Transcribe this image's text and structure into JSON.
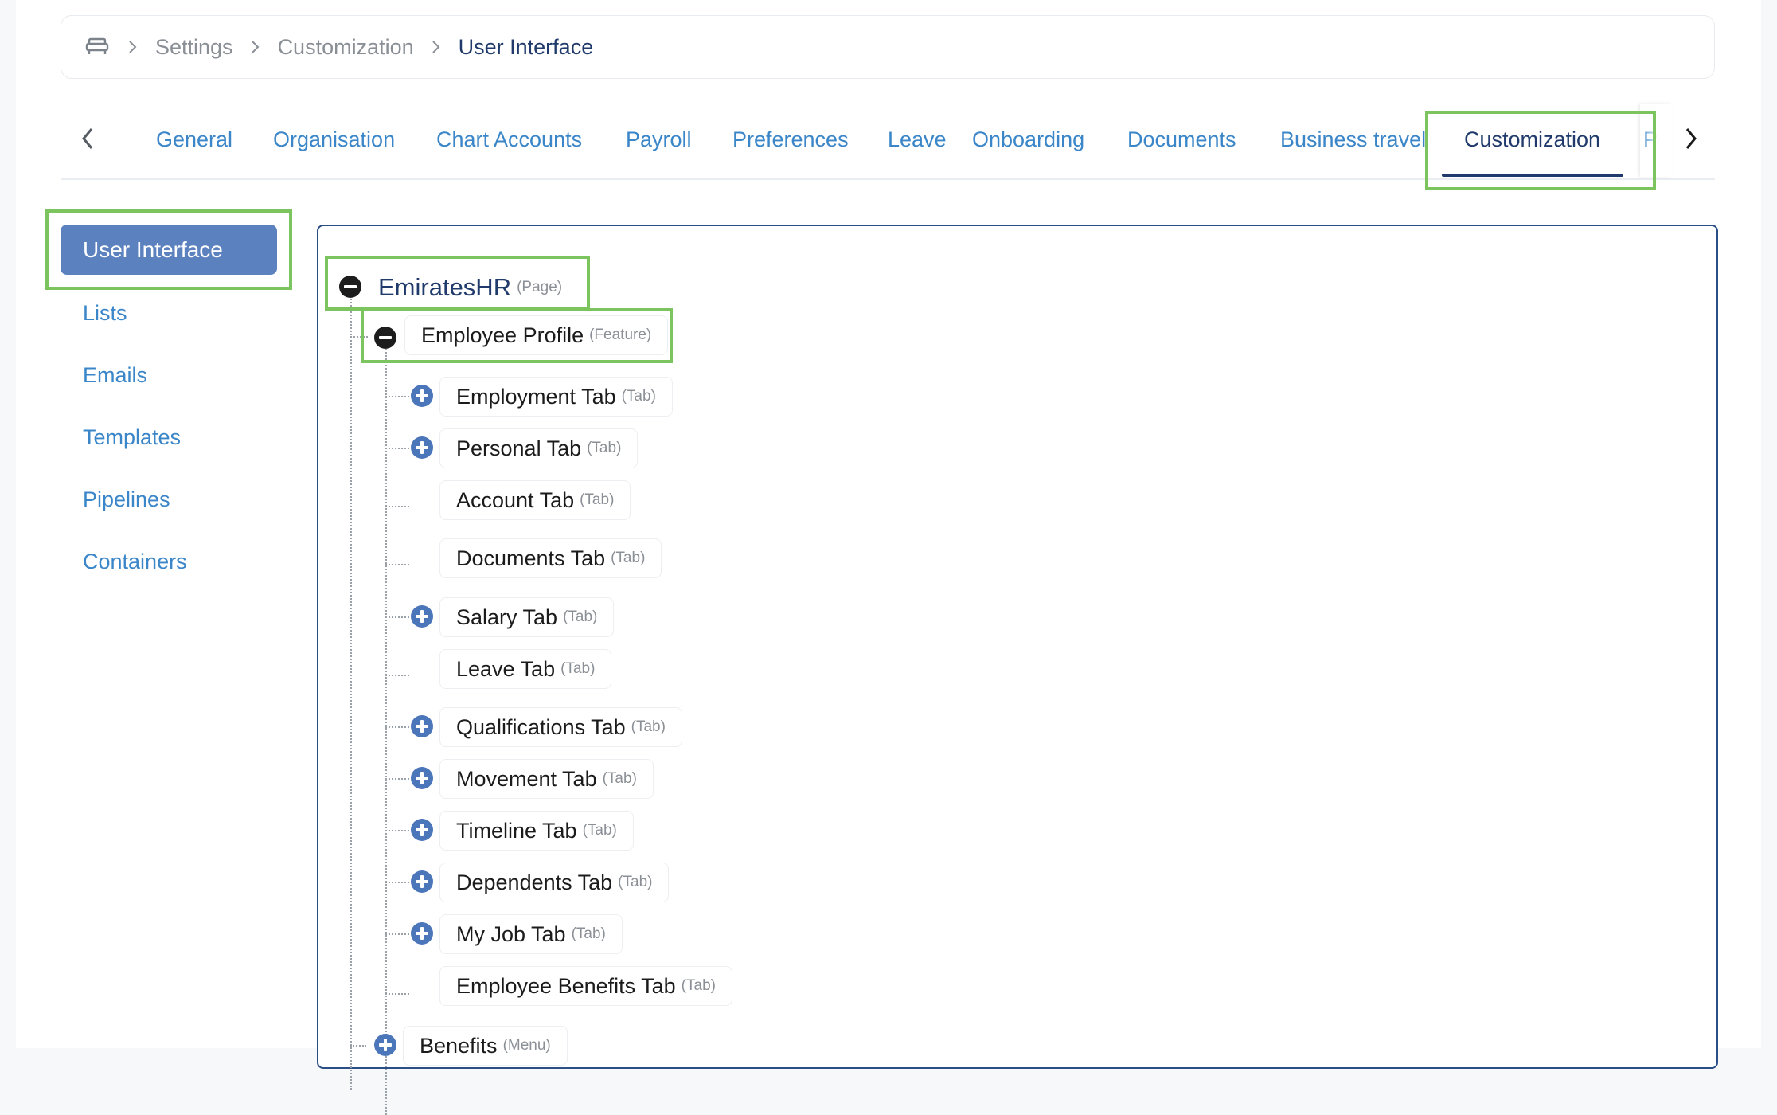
{
  "breadcrumb": {
    "items": [
      "Settings",
      "Customization",
      "User Interface"
    ]
  },
  "tabs": {
    "items": [
      "General",
      "Organisation",
      "Chart Accounts",
      "Payroll",
      "Preferences",
      "Leave",
      "Onboarding",
      "Documents",
      "Business travel",
      "Customization",
      "Pc"
    ],
    "active": "Customization"
  },
  "sidebar": {
    "active": "User Interface",
    "items": [
      "Lists",
      "Emails",
      "Templates",
      "Pipelines",
      "Containers"
    ]
  },
  "tree": {
    "root": {
      "label": "EmiratesHR",
      "type": "(Page)"
    },
    "feature": {
      "label": "Employee Profile",
      "type": "(Feature)"
    },
    "tabs": [
      {
        "label": "Employment Tab",
        "type": "(Tab)",
        "expandable": true
      },
      {
        "label": "Personal Tab",
        "type": "(Tab)",
        "expandable": true
      },
      {
        "label": "Account Tab",
        "type": "(Tab)",
        "expandable": false
      },
      {
        "label": "Documents Tab",
        "type": "(Tab)",
        "expandable": false
      },
      {
        "label": "Salary Tab",
        "type": "(Tab)",
        "expandable": true
      },
      {
        "label": "Leave Tab",
        "type": "(Tab)",
        "expandable": false
      },
      {
        "label": "Qualifications Tab",
        "type": "(Tab)",
        "expandable": true
      },
      {
        "label": "Movement Tab",
        "type": "(Tab)",
        "expandable": true
      },
      {
        "label": "Timeline Tab",
        "type": "(Tab)",
        "expandable": true
      },
      {
        "label": "Dependents Tab",
        "type": "(Tab)",
        "expandable": true
      },
      {
        "label": "My Job Tab",
        "type": "(Tab)",
        "expandable": true
      },
      {
        "label": "Employee Benefits Tab",
        "type": "(Tab)",
        "expandable": false
      }
    ],
    "menu": {
      "label": "Benefits",
      "type": "(Menu)"
    }
  },
  "colors": {
    "accent_blue": "#3a86c8",
    "navy": "#1f3a6b",
    "active_bg": "#5b82bf",
    "highlight_green": "#7cc55e",
    "plus_icon": "#4c76ba"
  },
  "icons": {
    "home": "sofa-icon",
    "separator": "chevron-right-icon",
    "tabs_prev": "chevron-left-icon",
    "tabs_next": "chevron-right-icon",
    "collapse": "minus-circle-icon",
    "expand": "plus-circle-icon"
  }
}
